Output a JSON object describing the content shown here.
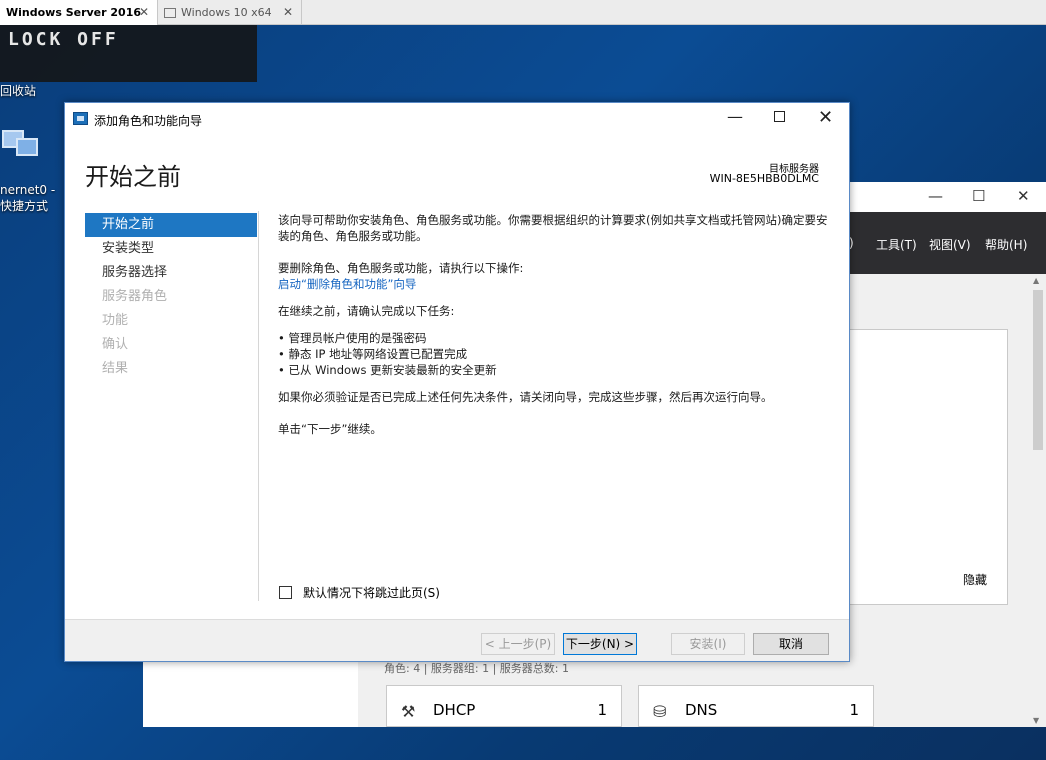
{
  "vm_tabs": [
    {
      "label": "Windows Server 2016"
    },
    {
      "label": "Windows 10 x64"
    }
  ],
  "lock_text": "LOCK OFF",
  "desktop": {
    "recycle_label": "回收站",
    "net_label_line1": "nernet0 -",
    "net_label_line2": "快捷方式"
  },
  "server_manager": {
    "menus": [
      ")",
      "工具(T)",
      "视图(V)",
      "帮助(H)"
    ],
    "hide_label": "隐藏",
    "summary": "角色: 4 | 服务器组: 1 | 服务器总数: 1",
    "cards": [
      {
        "name": "DHCP",
        "count": "1"
      },
      {
        "name": "DNS",
        "count": "1"
      }
    ]
  },
  "wizard": {
    "title": "添加角色和功能向导",
    "heading": "开始之前",
    "target_label": "目标服务器",
    "target_value": "WIN-8E5HBB0DLMC",
    "nav": [
      {
        "label": "开始之前",
        "state": "active"
      },
      {
        "label": "安装类型",
        "state": "enabled"
      },
      {
        "label": "服务器选择",
        "state": "enabled"
      },
      {
        "label": "服务器角色",
        "state": "disabled"
      },
      {
        "label": "功能",
        "state": "disabled"
      },
      {
        "label": "确认",
        "state": "disabled"
      },
      {
        "label": "结果",
        "state": "disabled"
      }
    ],
    "content": {
      "intro": "该向导可帮助你安装角色、角色服务或功能。你需要根据组织的计算要求(例如共享文档或托管网站)确定要安装的角色、角色服务或功能。",
      "remove_prompt": "要删除角色、角色服务或功能，请执行以下操作:",
      "remove_link": "启动“删除角色和功能”向导",
      "tasks_prompt": "在继续之前，请确认完成以下任务:",
      "tasks": [
        "管理员帐户使用的是强密码",
        "静态 IP 地址等网络设置已配置完成",
        "已从 Windows 更新安装最新的安全更新"
      ],
      "prereq_note": "如果你必须验证是否已完成上述任何先决条件，请关闭向导，完成这些步骤，然后再次运行向导。",
      "continue_note": "单击“下一步”继续。"
    },
    "skip_label": "默认情况下将跳过此页(S)",
    "skip_checked": false,
    "buttons": {
      "prev": "< 上一步(P)",
      "next": "下一步(N) >",
      "install": "安装(I)",
      "cancel": "取消"
    }
  }
}
